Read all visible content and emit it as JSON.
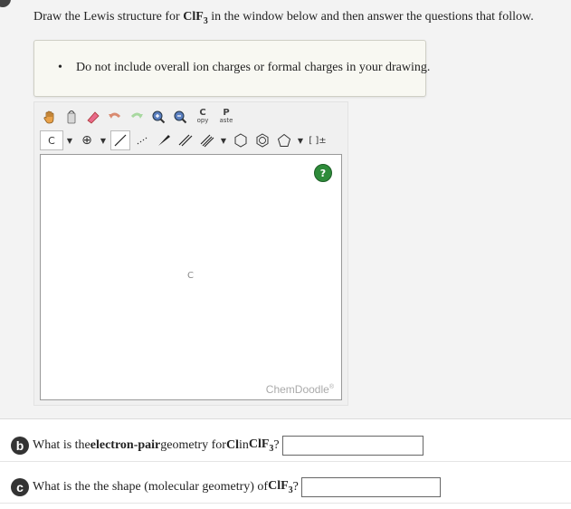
{
  "instruction": {
    "prefix": "Draw the Lewis structure for ",
    "formula_main": "ClF",
    "formula_sub": "3",
    "suffix": " in the window below and then answer the questions that follow."
  },
  "note": {
    "bullet": "•",
    "text": "Do not include overall ion charges or formal charges in your drawing."
  },
  "chemdoodle": {
    "copy_top": "C",
    "copy_bottom": "opy",
    "paste_top": "P",
    "paste_bottom": "aste",
    "element_selector": "C",
    "charge_symbol": "⊕",
    "bracket_label": "[ ]±",
    "help_label": "?",
    "canvas_atom": "C",
    "brand": "ChemDoodle",
    "brand_mark": "®"
  },
  "question_b": {
    "badge": "b",
    "prefix": "What is the ",
    "bold": "electron-pair",
    "middle": " geometry for ",
    "atom": "Cl",
    "in": " in ",
    "formula_main": "ClF",
    "formula_sub": "3",
    "suffix": " ?",
    "answer_value": ""
  },
  "question_c": {
    "badge": "c",
    "prefix": "What is the the shape (molecular geometry) of ",
    "formula_main": "ClF",
    "formula_sub": "3",
    "suffix": "?",
    "answer_value": ""
  }
}
